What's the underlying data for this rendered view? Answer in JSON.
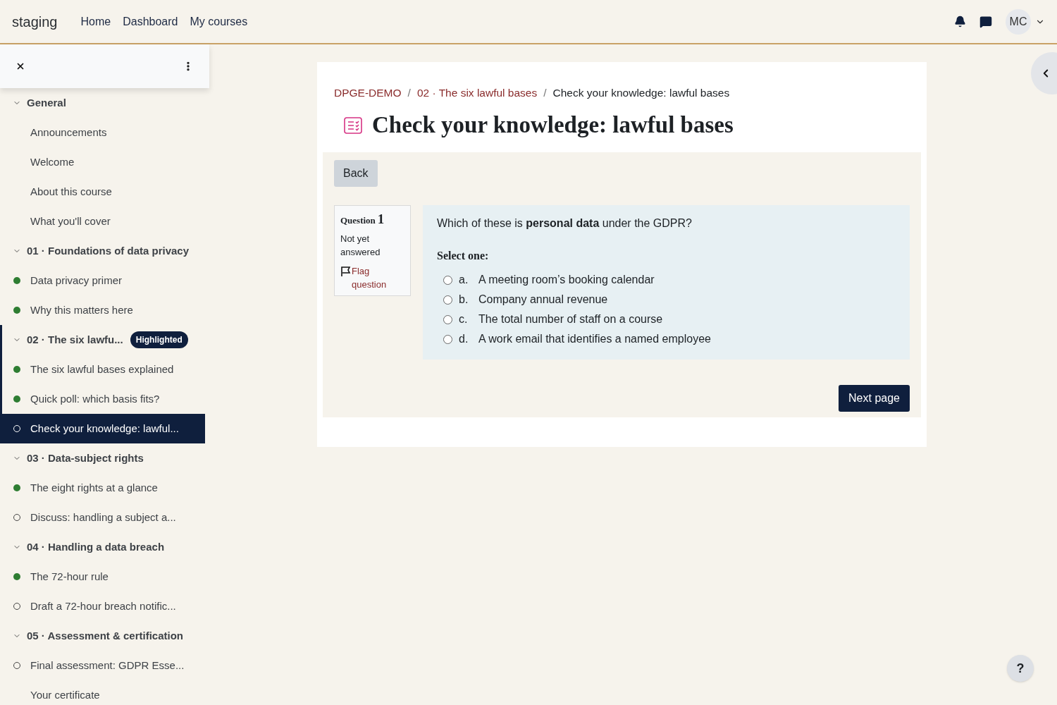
{
  "navbar": {
    "brand": "staging",
    "links": [
      "Home",
      "Dashboard",
      "My courses"
    ],
    "avatar": "MC"
  },
  "sidebar": {
    "sections": [
      {
        "title": "General",
        "expanded": true,
        "highlighted": false,
        "items": [
          {
            "label": "Announcements",
            "kind": "plain",
            "selected": false
          },
          {
            "label": "Welcome",
            "kind": "plain",
            "selected": false
          },
          {
            "label": "About this course",
            "kind": "plain",
            "selected": false
          },
          {
            "label": "What you'll cover",
            "kind": "plain",
            "selected": false
          }
        ]
      },
      {
        "title": "01 · Foundations of data privacy",
        "expanded": true,
        "highlighted": false,
        "items": [
          {
            "label": "Data privacy primer",
            "kind": "complete",
            "selected": false
          },
          {
            "label": "Why this matters here",
            "kind": "complete",
            "selected": false
          }
        ]
      },
      {
        "title": "02 · The six lawfu...",
        "expanded": true,
        "highlighted": true,
        "badge": "Highlighted",
        "items": [
          {
            "label": "The six lawful bases explained",
            "kind": "complete",
            "selected": false
          },
          {
            "label": "Quick poll: which basis fits?",
            "kind": "complete",
            "selected": false
          },
          {
            "label": "Check your knowledge: lawful...",
            "kind": "incomplete",
            "selected": true
          }
        ]
      },
      {
        "title": "03 · Data-subject rights",
        "expanded": true,
        "highlighted": false,
        "items": [
          {
            "label": "The eight rights at a glance",
            "kind": "complete",
            "selected": false
          },
          {
            "label": "Discuss: handling a subject a...",
            "kind": "incomplete",
            "selected": false
          }
        ]
      },
      {
        "title": "04 · Handling a data breach",
        "expanded": true,
        "highlighted": false,
        "items": [
          {
            "label": "The 72-hour rule",
            "kind": "complete",
            "selected": false
          },
          {
            "label": "Draft a 72-hour breach notific...",
            "kind": "incomplete",
            "selected": false
          }
        ]
      },
      {
        "title": "05 · Assessment & certification",
        "expanded": true,
        "highlighted": false,
        "items": [
          {
            "label": "Final assessment: GDPR Esse...",
            "kind": "incomplete",
            "selected": false
          },
          {
            "label": "Your certificate",
            "kind": "plain",
            "selected": false
          }
        ]
      }
    ]
  },
  "breadcrumb": [
    {
      "label": "DPGE-DEMO",
      "kind": "link"
    },
    {
      "label": "/",
      "kind": "separator"
    },
    {
      "label": "02 · The six lawful bases",
      "kind": "link"
    },
    {
      "label": "/",
      "kind": "separator"
    },
    {
      "label": "Check your knowledge: lawful bases",
      "kind": "current"
    }
  ],
  "title": "Check your knowledge: lawful bases",
  "back_button": "Back",
  "question": {
    "label": "Question",
    "number": "1",
    "state": "Not yet answered",
    "flag": "Flag question",
    "flagged": false,
    "text": "Which of these is **personal data** under the GDPR?",
    "prompt": "Select one:",
    "options": [
      {
        "letter": "a.",
        "text": "A meeting room’s booking calendar",
        "selected": false
      },
      {
        "letter": "b.",
        "text": "Company annual revenue",
        "selected": false
      },
      {
        "letter": "c.",
        "text": "The total number of staff on a course",
        "selected": false
      },
      {
        "letter": "d.",
        "text": "A work email that identifies a named employee",
        "selected": false
      }
    ]
  },
  "next_button": "Next page",
  "help_button": "?"
}
